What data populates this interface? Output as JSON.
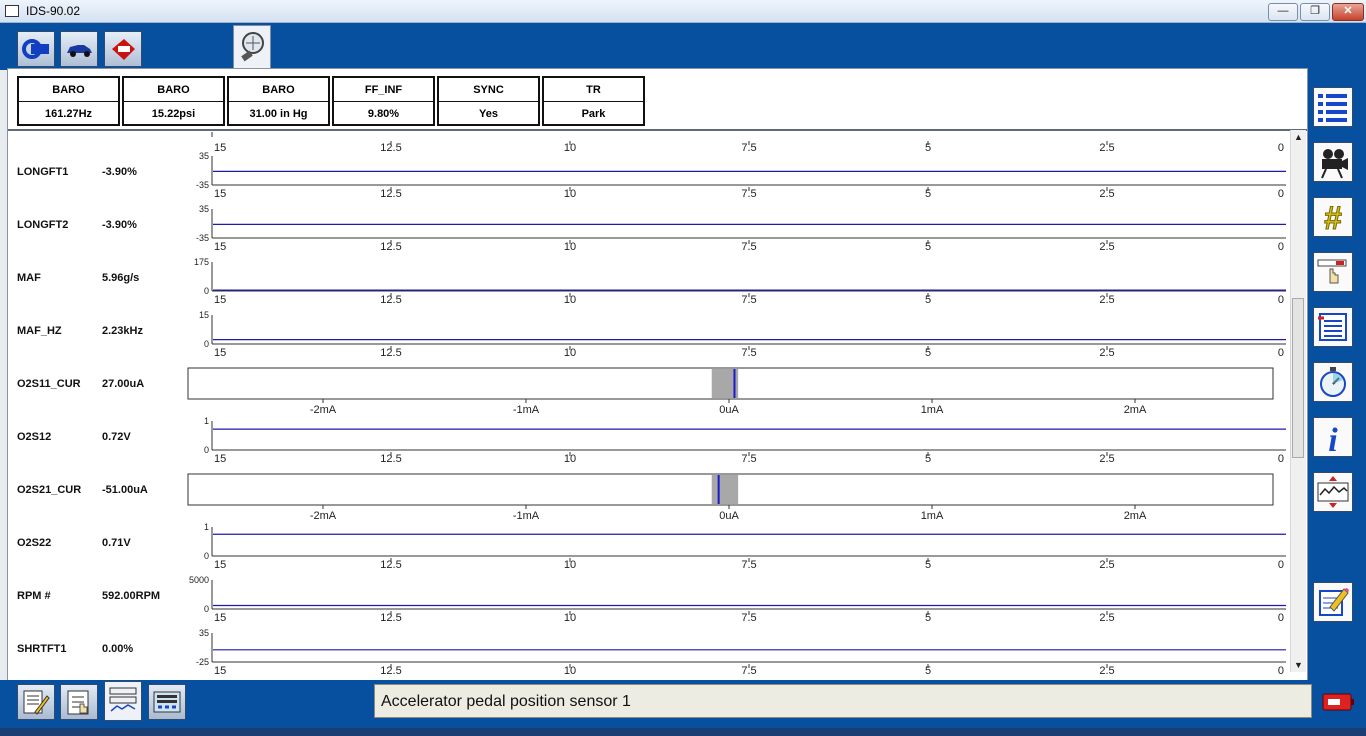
{
  "window": {
    "title": "IDS-90.02"
  },
  "pid_table": [
    {
      "name": "BARO",
      "value": "161.27Hz"
    },
    {
      "name": "BARO",
      "value": "15.22psi"
    },
    {
      "name": "BARO",
      "value": "31.00 in Hg"
    },
    {
      "name": "FF_INF",
      "value": "9.80%"
    },
    {
      "name": "SYNC",
      "value": "Yes"
    },
    {
      "name": "TR",
      "value": "Park"
    }
  ],
  "time_ticks": [
    "15",
    "12.5",
    "10",
    "7.5",
    "5",
    "2.5",
    "0"
  ],
  "bar_ticks": [
    "-2mA",
    "-1mA",
    "0uA",
    "1mA",
    "2mA"
  ],
  "signals": [
    {
      "name": "LONGFT1",
      "value": "-3.90%",
      "kind": "graph",
      "ymax": "35",
      "ymin": "-35",
      "level": 0.47
    },
    {
      "name": "LONGFT2",
      "value": "-3.90%",
      "kind": "graph",
      "ymax": "35",
      "ymin": "-35",
      "level": 0.47
    },
    {
      "name": "MAF",
      "value": "5.96g/s",
      "kind": "graph",
      "ymax": "175",
      "ymin": "0",
      "level": 0.03
    },
    {
      "name": "MAF_HZ",
      "value": "2.23kHz",
      "kind": "graph",
      "ymax": "15",
      "ymin": "0",
      "level": 0.15
    },
    {
      "name": "O2S11_CUR",
      "value": "27.00uA",
      "kind": "bar",
      "current_ua": 27
    },
    {
      "name": "O2S12",
      "value": "0.72V",
      "kind": "graph",
      "ymax": "1",
      "ymin": "0",
      "level": 0.72
    },
    {
      "name": "O2S21_CUR",
      "value": "-51.00uA",
      "kind": "bar",
      "current_ua": -51
    },
    {
      "name": "O2S22",
      "value": "0.71V",
      "kind": "graph",
      "ymax": "1",
      "ymin": "0",
      "level": 0.75
    },
    {
      "name": "RPM #",
      "value": "592.00RPM",
      "kind": "graph",
      "ymax": "5000",
      "ymin": "0",
      "level": 0.12
    },
    {
      "name": "SHRTFT1",
      "value": "0.00%",
      "kind": "graph",
      "ymax": "35",
      "ymin": "-25",
      "level": 0.42
    }
  ],
  "status": {
    "text": "Accelerator pedal position sensor 1"
  },
  "colors": {
    "trace": "#1c1ca8",
    "toolbar_blue": "#0750a0",
    "bar_marker": "#1a1acc",
    "bar_zero_zone": "#a8a8a8"
  },
  "icons": {
    "top_toolbar": [
      "connect-icon",
      "vehicle-icon",
      "toolbox-icon",
      "datalogger-icon"
    ],
    "right_toolbar": [
      "pid-list-icon",
      "record-camera-icon",
      "hash-icon",
      "trigger-icon",
      "list-config-icon",
      "stopwatch-icon",
      "info-icon",
      "graph-scale-icon",
      "edit-icon"
    ],
    "bottom_toolbar": [
      "notes-icon",
      "checklist-icon",
      "graph-view-icon",
      "recorder-icon"
    ],
    "status": "battery-icon"
  }
}
